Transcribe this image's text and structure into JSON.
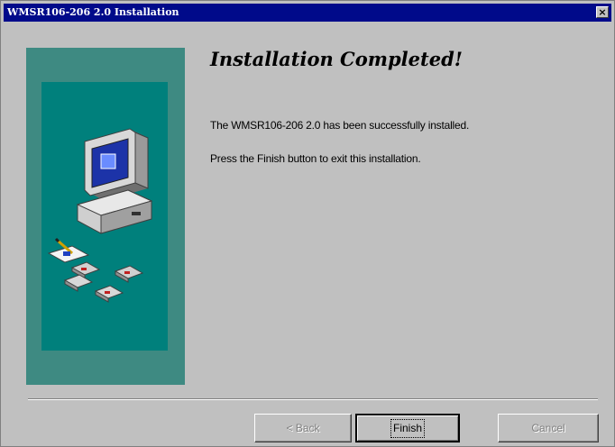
{
  "window": {
    "title": "WMSR106-206 2.0 Installation",
    "close_glyph": "×"
  },
  "content": {
    "heading": "Installation Completed!",
    "message_1": "The WMSR106-206 2.0 has been successfully installed.",
    "message_2": "Press the Finish button to exit this installation."
  },
  "buttons": {
    "back_label": "< Back",
    "finish_label": "Finish",
    "cancel_label": "Cancel"
  },
  "colors": {
    "title_bar": "#000a8a",
    "panel_outer": "#3e8a82",
    "panel_inner": "#00807c",
    "dialog_bg": "#c0c0c0"
  },
  "icons": {
    "side_image": "computer-with-disks-icon"
  }
}
